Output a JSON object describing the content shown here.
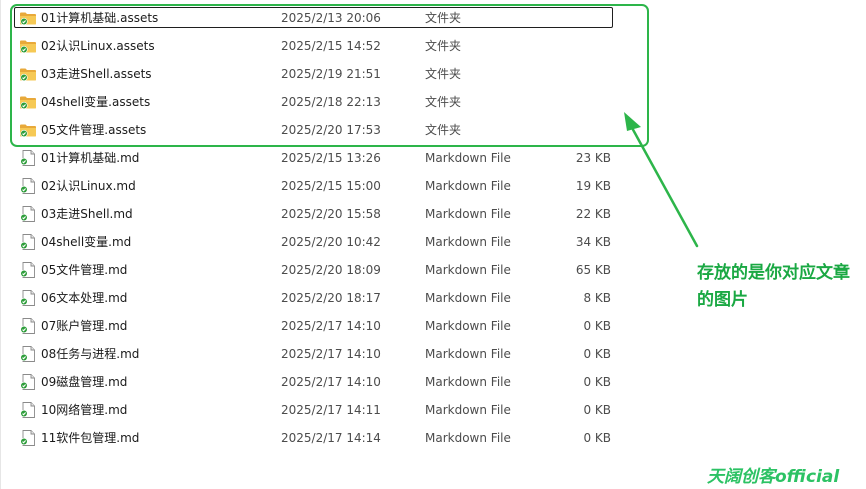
{
  "files": [
    {
      "name": "01计算机基础.assets",
      "date": "2025/2/13 20:06",
      "type": "文件夹",
      "size": "",
      "icon": "folder-icon",
      "selected": true
    },
    {
      "name": "02认识Linux.assets",
      "date": "2025/2/15 14:52",
      "type": "文件夹",
      "size": "",
      "icon": "folder-icon"
    },
    {
      "name": "03走进Shell.assets",
      "date": "2025/2/19 21:51",
      "type": "文件夹",
      "size": "",
      "icon": "folder-icon"
    },
    {
      "name": "04shell变量.assets",
      "date": "2025/2/18 22:13",
      "type": "文件夹",
      "size": "",
      "icon": "folder-icon"
    },
    {
      "name": "05文件管理.assets",
      "date": "2025/2/20 17:53",
      "type": "文件夹",
      "size": "",
      "icon": "folder-icon"
    },
    {
      "name": "01计算机基础.md",
      "date": "2025/2/15 13:26",
      "type": "Markdown File",
      "size": "23 KB",
      "icon": "markdown-file-icon"
    },
    {
      "name": "02认识Linux.md",
      "date": "2025/2/15 15:00",
      "type": "Markdown File",
      "size": "19 KB",
      "icon": "markdown-file-icon"
    },
    {
      "name": "03走进Shell.md",
      "date": "2025/2/20 15:58",
      "type": "Markdown File",
      "size": "22 KB",
      "icon": "markdown-file-icon"
    },
    {
      "name": "04shell变量.md",
      "date": "2025/2/20 10:42",
      "type": "Markdown File",
      "size": "34 KB",
      "icon": "markdown-file-icon"
    },
    {
      "name": "05文件管理.md",
      "date": "2025/2/20 18:09",
      "type": "Markdown File",
      "size": "65 KB",
      "icon": "markdown-file-icon"
    },
    {
      "name": "06文本处理.md",
      "date": "2025/2/20 18:17",
      "type": "Markdown File",
      "size": "8 KB",
      "icon": "markdown-file-icon"
    },
    {
      "name": "07账户管理.md",
      "date": "2025/2/17 14:10",
      "type": "Markdown File",
      "size": "0 KB",
      "icon": "markdown-file-icon"
    },
    {
      "name": "08任务与进程.md",
      "date": "2025/2/17 14:10",
      "type": "Markdown File",
      "size": "0 KB",
      "icon": "markdown-file-icon"
    },
    {
      "name": "09磁盘管理.md",
      "date": "2025/2/17 14:10",
      "type": "Markdown File",
      "size": "0 KB",
      "icon": "markdown-file-icon"
    },
    {
      "name": "10网络管理.md",
      "date": "2025/2/17 14:11",
      "type": "Markdown File",
      "size": "0 KB",
      "icon": "markdown-file-icon"
    },
    {
      "name": "11软件包管理.md",
      "date": "2025/2/17 14:14",
      "type": "Markdown File",
      "size": "0 KB",
      "icon": "markdown-file-icon"
    }
  ],
  "annotation": {
    "text": "存放的是你对应文章的图片",
    "color": "#1aa843"
  },
  "watermark": {
    "text": "天阔创客official"
  },
  "colors": {
    "highlight": "#2db54a",
    "folder": "#f3c14b",
    "sync_check": "#2d9d3a"
  }
}
